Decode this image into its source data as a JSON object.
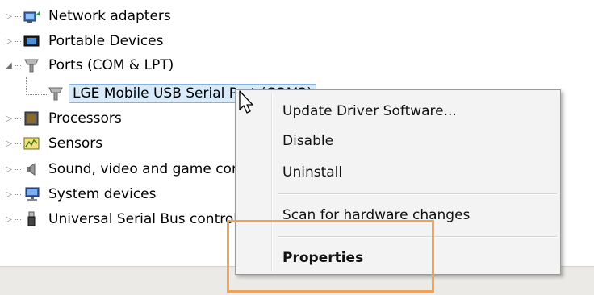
{
  "tree": {
    "items": [
      {
        "label": "Network adapters",
        "icon": "network-adapter-icon"
      },
      {
        "label": "Portable Devices",
        "icon": "portable-device-icon"
      },
      {
        "label": "Ports (COM & LPT)",
        "icon": "port-icon"
      },
      {
        "label": "LGE Mobile USB Serial Port (COM3)",
        "icon": "port-icon"
      },
      {
        "label": "Processors",
        "icon": "processor-icon"
      },
      {
        "label": "Sensors",
        "icon": "sensor-icon"
      },
      {
        "label": "Sound, video and game controllers",
        "icon": "speaker-icon"
      },
      {
        "label": "System devices",
        "icon": "system-device-icon"
      },
      {
        "label": "Universal Serial Bus controllers",
        "icon": "usb-icon"
      }
    ]
  },
  "context_menu": {
    "items": [
      {
        "label": "Update Driver Software..."
      },
      {
        "label": "Disable"
      },
      {
        "label": "Uninstall"
      },
      {
        "label": "Scan for hardware changes"
      },
      {
        "label": "Properties"
      }
    ]
  },
  "colors": {
    "highlight_box": "#f0a257",
    "selection_bg": "#d9ebfb",
    "menu_bg": "#f3f3f3"
  }
}
